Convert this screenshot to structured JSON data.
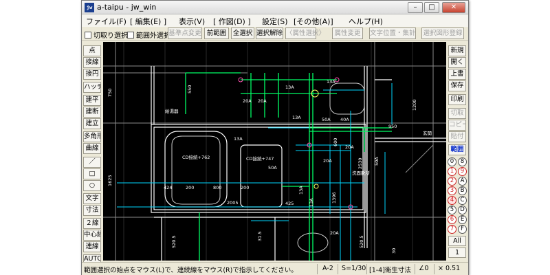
{
  "window": {
    "title": "a-taipu - jw_win",
    "app_icon": "jw",
    "controls": {
      "minimize": "0",
      "maximize": "1",
      "close": "r"
    }
  },
  "menu": [
    "ファイル(F)",
    "[ 編集(E) ]",
    "表示(V)",
    "[ 作図(D) ]",
    "設定(S)",
    "[その他(A)]",
    "ヘルプ(H)"
  ],
  "toolbar": {
    "checkboxes": [
      "切取り選択",
      "範囲外選択"
    ],
    "buttons": [
      {
        "label": "基準点変更",
        "enabled": false
      },
      {
        "label": "前範囲",
        "enabled": true
      },
      {
        "label": "全選択",
        "enabled": true
      },
      {
        "label": "選択解除",
        "enabled": true
      },
      {
        "label": "〈属性選択〉",
        "enabled": false
      },
      {
        "label": "属性変更",
        "enabled": false
      },
      {
        "label": "文字位置・集計",
        "enabled": false
      },
      {
        "label": "選択図形登録",
        "enabled": false
      }
    ]
  },
  "left_tools": [
    "点",
    "接線",
    "接円",
    "ハッチ",
    "建平",
    "建断",
    "建立",
    "多角形",
    "曲線",
    "／",
    "□",
    "○",
    "文字",
    "寸法",
    "２線",
    "中心線",
    "連線",
    "AUTO"
  ],
  "right_tools": [
    {
      "label": "新規",
      "enabled": true
    },
    {
      "label": "開く",
      "enabled": true
    },
    {
      "label": "上書",
      "enabled": true
    },
    {
      "label": "保存",
      "enabled": true
    },
    {
      "label": "印刷",
      "enabled": true
    },
    {
      "label": "切取",
      "enabled": false
    },
    {
      "label": "コピー",
      "enabled": false
    },
    {
      "label": "貼付",
      "enabled": false
    },
    {
      "label": "範囲",
      "enabled": true,
      "active": true
    }
  ],
  "layers": [
    {
      "num": "0",
      "group": "8"
    },
    {
      "num": "1",
      "group": "9"
    },
    {
      "num": "2",
      "group": "A"
    },
    {
      "num": "3",
      "group": "B"
    },
    {
      "num": "4",
      "group": "C",
      "active": true
    },
    {
      "num": "5",
      "group": "D"
    },
    {
      "num": "6",
      "group": "E"
    },
    {
      "num": "7",
      "group": "F"
    }
  ],
  "layer_buttons": {
    "all": "All",
    "one": "1"
  },
  "drawing": {
    "labels": [
      "750",
      "1625",
      "1200",
      "550",
      "20A",
      "20A",
      "20A",
      "13A",
      "13A",
      "13A",
      "13A",
      "給湯器",
      "玄関",
      "CD接続+762",
      "CD接続+747",
      "50A",
      "424",
      "200",
      "800",
      "200",
      "2005",
      "425",
      "洗面脱所",
      "20A",
      "40A",
      "50A",
      "1396",
      "2530",
      "600",
      "950",
      "13A",
      "13A",
      "520.5",
      "31.5",
      "50A",
      "20A",
      "520.5",
      "30"
    ]
  },
  "status": {
    "message": "範囲選択の始点をマウス(L)で、連続線をマウス(R)で指示してください。",
    "grid": "A-2",
    "scale": "S=1/30",
    "layer": "[1-4]衛生寸法",
    "angle": "∠0",
    "zoom": "× 0.51"
  },
  "colors": {
    "canvas_bg": "#000000",
    "wall_line": "#ffffff",
    "pipe_green": "#00ff66",
    "dim_cyan": "#00d8ff",
    "gray_line": "#909090",
    "dim_pink": "#ff4fb0",
    "selected_layer": "#cc2222"
  }
}
